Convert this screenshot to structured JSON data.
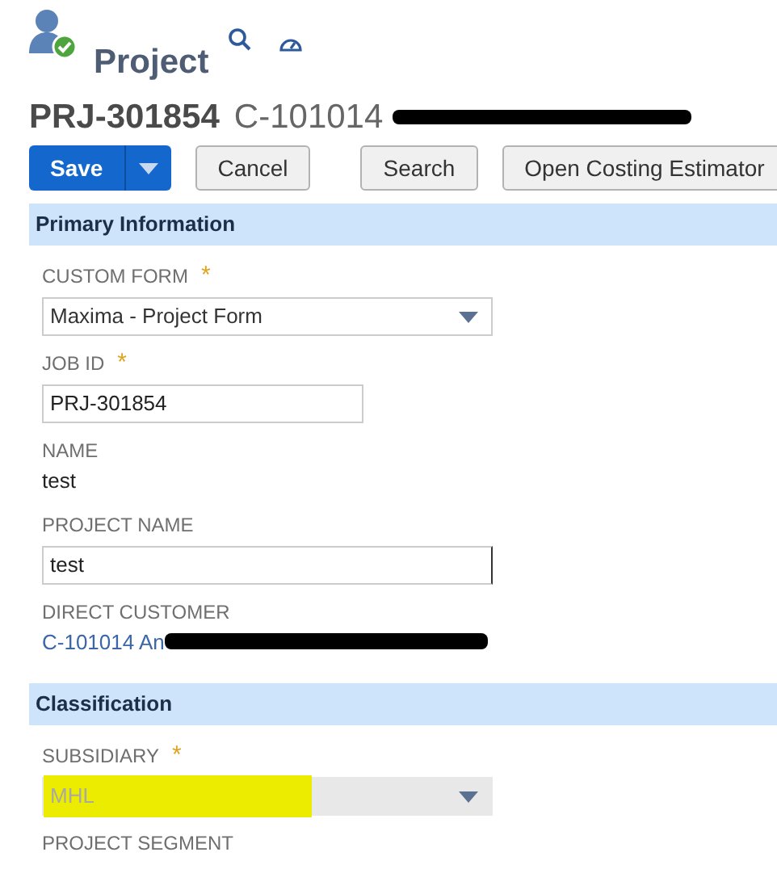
{
  "header": {
    "title": "Project",
    "record_id": "PRJ-301854",
    "record_subtitle": "C-101014",
    "redacted": true
  },
  "actions": [
    {
      "kind": "split",
      "label": "Save"
    },
    {
      "kind": "plain",
      "label": "Cancel"
    },
    {
      "kind": "separator"
    },
    {
      "kind": "plain",
      "label": "Search"
    },
    {
      "kind": "plain",
      "label": "Open Costing Estimator"
    }
  ],
  "sections": [
    {
      "title": "Primary Information",
      "fields": [
        {
          "kind": "select",
          "label": "CUSTOM FORM",
          "required_mark": "*",
          "disabled": false,
          "value": "Maxima - Project Form"
        },
        {
          "kind": "text",
          "label": "JOB ID",
          "required_mark": "*",
          "value": "PRJ-301854"
        },
        {
          "kind": "static",
          "label": "NAME",
          "value": "test"
        },
        {
          "kind": "text",
          "label": "PROJECT NAME",
          "value": "test"
        },
        {
          "kind": "link",
          "label": "DIRECT CUSTOMER",
          "redacted": true,
          "value": "C-101014 An"
        }
      ]
    },
    {
      "title": "Classification",
      "fields": [
        {
          "kind": "select",
          "label": "SUBSIDIARY",
          "required_mark": "*",
          "disabled": true,
          "highlighted": true,
          "value": "MHL"
        },
        {
          "kind": "label_only",
          "label": "PROJECT SEGMENT"
        }
      ]
    }
  ]
}
